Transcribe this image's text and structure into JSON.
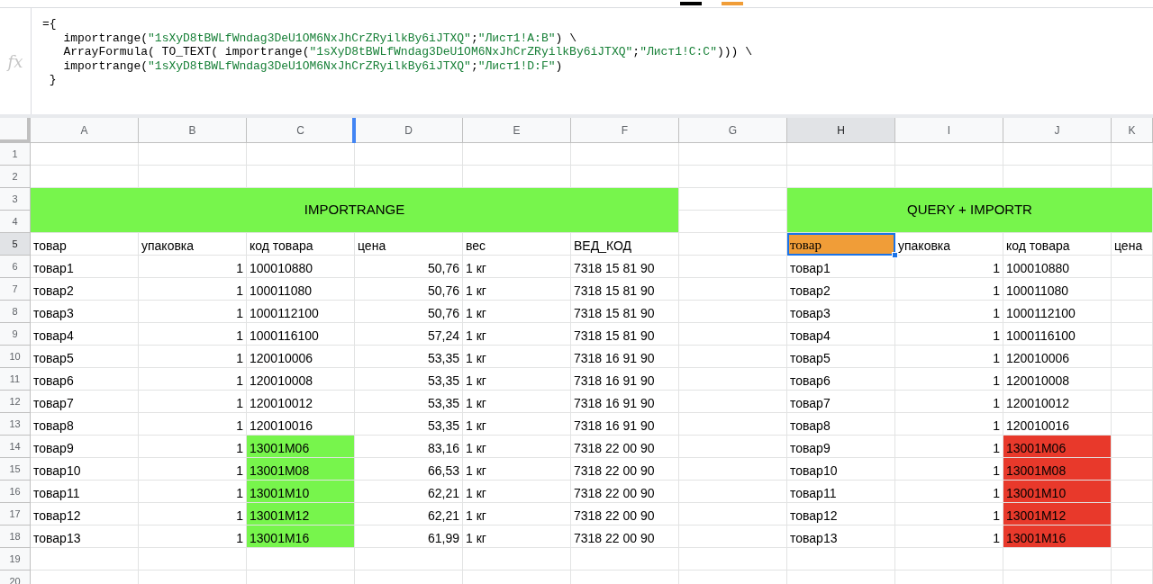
{
  "formula_bar": {
    "icon": "fx",
    "lines": [
      [
        {
          "kind": "plain",
          "text": "={"
        }
      ],
      [
        {
          "kind": "plain",
          "text": "   importrange("
        },
        {
          "kind": "string",
          "text": "\"1sXyD8tBWLfWndag3DeU1OM6NxJhCrZRyilkBy6iJTXQ\""
        },
        {
          "kind": "plain",
          "text": ";"
        },
        {
          "kind": "string",
          "text": "\"Лист1!A:B\""
        },
        {
          "kind": "plain",
          "text": ") \\"
        }
      ],
      [
        {
          "kind": "plain",
          "text": "   ArrayFormula( TO_TEXT( importrange("
        },
        {
          "kind": "string",
          "text": "\"1sXyD8tBWLfWndag3DeU1OM6NxJhCrZRyilkBy6iJTXQ\""
        },
        {
          "kind": "plain",
          "text": ";"
        },
        {
          "kind": "string",
          "text": "\"Лист1!C:C\""
        },
        {
          "kind": "plain",
          "text": "))) \\"
        }
      ],
      [
        {
          "kind": "plain",
          "text": "   importrange("
        },
        {
          "kind": "string",
          "text": "\"1sXyD8tBWLfWndag3DeU1OM6NxJhCrZRyilkBy6iJTXQ\""
        },
        {
          "kind": "plain",
          "text": ";"
        },
        {
          "kind": "string",
          "text": "\"Лист1!D:F\""
        },
        {
          "kind": "plain",
          "text": ")"
        }
      ],
      [
        {
          "kind": "plain",
          "text": " }"
        }
      ]
    ]
  },
  "columns": [
    {
      "label": "A",
      "selected": false
    },
    {
      "label": "B",
      "selected": false
    },
    {
      "label": "C",
      "selected": false
    },
    {
      "label": "D",
      "selected": false
    },
    {
      "label": "E",
      "selected": false
    },
    {
      "label": "F",
      "selected": false
    },
    {
      "label": "G",
      "selected": false
    },
    {
      "label": "H",
      "selected": true
    },
    {
      "label": "I",
      "selected": false
    },
    {
      "label": "J",
      "selected": false
    },
    {
      "label": "K",
      "selected": false
    }
  ],
  "row_numbers": [
    {
      "label": "1",
      "selected": false
    },
    {
      "label": "2",
      "selected": false
    },
    {
      "label": "3",
      "selected": false
    },
    {
      "label": "4",
      "selected": false
    },
    {
      "label": "5",
      "selected": true
    },
    {
      "label": "6",
      "selected": false
    },
    {
      "label": "7",
      "selected": false
    },
    {
      "label": "8",
      "selected": false
    },
    {
      "label": "9",
      "selected": false
    },
    {
      "label": "10",
      "selected": false
    },
    {
      "label": "11",
      "selected": false
    },
    {
      "label": "12",
      "selected": false
    },
    {
      "label": "13",
      "selected": false
    },
    {
      "label": "14",
      "selected": false
    },
    {
      "label": "15",
      "selected": false
    },
    {
      "label": "16",
      "selected": false
    },
    {
      "label": "17",
      "selected": false
    },
    {
      "label": "18",
      "selected": false
    },
    {
      "label": "19",
      "selected": false
    },
    {
      "label": "20",
      "selected": false
    }
  ],
  "left_table": {
    "title": "IMPORTRANGE",
    "headers": [
      {
        "text": "товар",
        "selected": false
      },
      {
        "text": "упаковка",
        "selected": false
      },
      {
        "text": "код товара",
        "selected": false
      },
      {
        "text": "цена",
        "selected": false
      },
      {
        "text": "вес",
        "selected": false
      },
      {
        "text": "ВЕД_КОД",
        "selected": false
      }
    ],
    "rows": [
      {
        "cells": [
          "товар1",
          "1",
          "100010880",
          "50,76",
          "1 кг",
          "7318 15 81 90"
        ],
        "highlighted": false
      },
      {
        "cells": [
          "товар2",
          "1",
          "100011080",
          "50,76",
          "1 кг",
          "7318 15 81 90"
        ],
        "highlighted": false
      },
      {
        "cells": [
          "товар3",
          "1",
          "1000112100",
          "50,76",
          "1 кг",
          "7318 15 81 90"
        ],
        "highlighted": false
      },
      {
        "cells": [
          "товар4",
          "1",
          "1000116100",
          "57,24",
          "1 кг",
          "7318 15 81 90"
        ],
        "highlighted": false
      },
      {
        "cells": [
          "товар5",
          "1",
          "120010006",
          "53,35",
          "1 кг",
          "7318 16 91 90"
        ],
        "highlighted": false
      },
      {
        "cells": [
          "товар6",
          "1",
          "120010008",
          "53,35",
          "1 кг",
          "7318 16 91 90"
        ],
        "highlighted": false
      },
      {
        "cells": [
          "товар7",
          "1",
          "120010012",
          "53,35",
          "1 кг",
          "7318 16 91 90"
        ],
        "highlighted": false
      },
      {
        "cells": [
          "товар8",
          "1",
          "120010016",
          "53,35",
          "1 кг",
          "7318 16 91 90"
        ],
        "highlighted": false
      },
      {
        "cells": [
          "товар9",
          "1",
          "13001M06",
          "83,16",
          "1 кг",
          "7318 22 00 90"
        ],
        "highlighted": true
      },
      {
        "cells": [
          "товар10",
          "1",
          "13001M08",
          "66,53",
          "1 кг",
          "7318 22 00 90"
        ],
        "highlighted": true
      },
      {
        "cells": [
          "товар11",
          "1",
          "13001M10",
          "62,21",
          "1 кг",
          "7318 22 00 90"
        ],
        "highlighted": true
      },
      {
        "cells": [
          "товар12",
          "1",
          "13001M12",
          "62,21",
          "1 кг",
          "7318 22 00 90"
        ],
        "highlighted": true
      },
      {
        "cells": [
          "товар13",
          "1",
          "13001M16",
          "61,99",
          "1 кг",
          "7318 22 00 90"
        ],
        "highlighted": true
      }
    ]
  },
  "right_table": {
    "title": "QUERY + IMPORTR",
    "headers": [
      {
        "text": "товар",
        "selected": true
      },
      {
        "text": "упаковка",
        "selected": false
      },
      {
        "text": "код товара",
        "selected": false
      },
      {
        "text": "цена",
        "selected": false
      }
    ],
    "rows": [
      {
        "cells": [
          "товар1",
          "1",
          "100010880"
        ],
        "highlighted": false
      },
      {
        "cells": [
          "товар2",
          "1",
          "100011080"
        ],
        "highlighted": false
      },
      {
        "cells": [
          "товар3",
          "1",
          "1000112100"
        ],
        "highlighted": false
      },
      {
        "cells": [
          "товар4",
          "1",
          "1000116100"
        ],
        "highlighted": false
      },
      {
        "cells": [
          "товар5",
          "1",
          "120010006"
        ],
        "highlighted": false
      },
      {
        "cells": [
          "товар6",
          "1",
          "120010008"
        ],
        "highlighted": false
      },
      {
        "cells": [
          "товар7",
          "1",
          "120010012"
        ],
        "highlighted": false
      },
      {
        "cells": [
          "товар8",
          "1",
          "120010016"
        ],
        "highlighted": false
      },
      {
        "cells": [
          "товар9",
          "1",
          "13001M06"
        ],
        "highlighted": true
      },
      {
        "cells": [
          "товар10",
          "1",
          "13001M08"
        ],
        "highlighted": true
      },
      {
        "cells": [
          "товар11",
          "1",
          "13001M10"
        ],
        "highlighted": true
      },
      {
        "cells": [
          "товар12",
          "1",
          "13001M12"
        ],
        "highlighted": true
      },
      {
        "cells": [
          "товар13",
          "1",
          "13001M16"
        ],
        "highlighted": true
      }
    ]
  }
}
